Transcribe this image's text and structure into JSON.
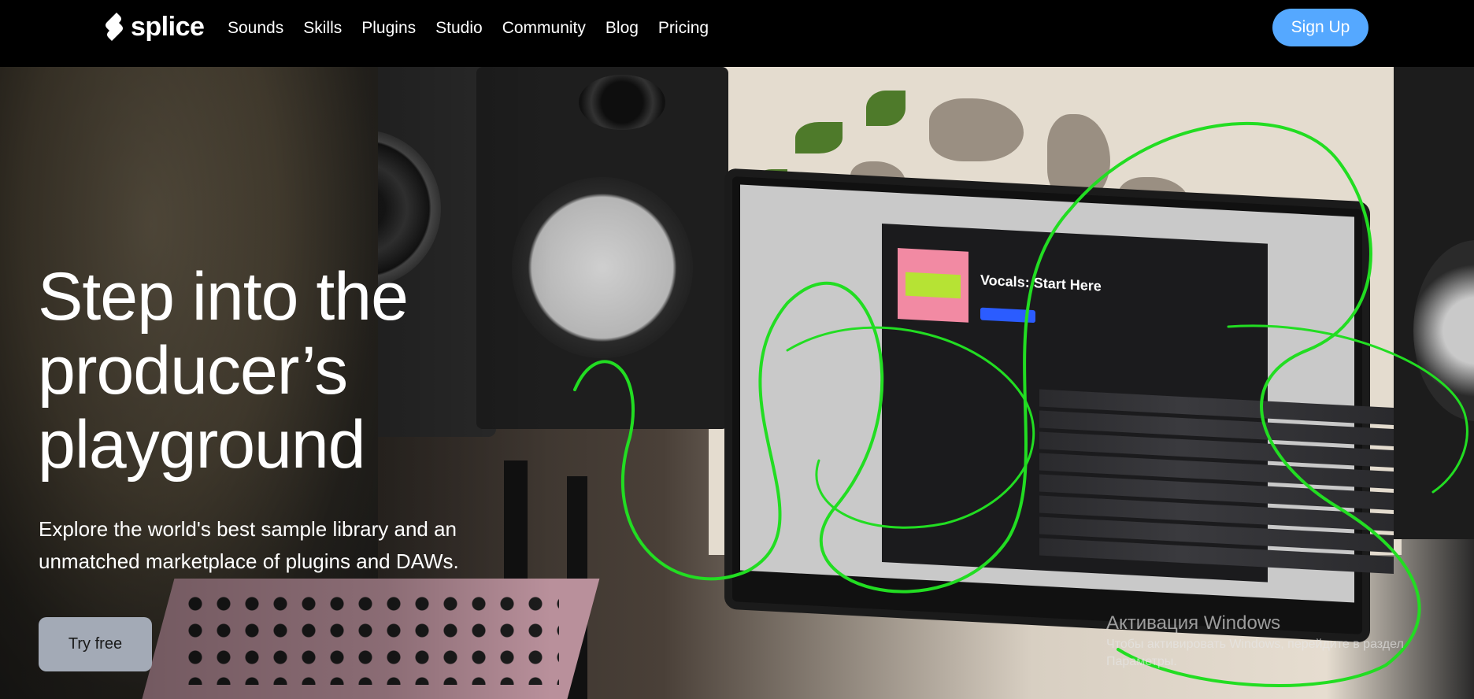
{
  "header": {
    "logo_text": "splice",
    "nav": [
      "Sounds",
      "Skills",
      "Plugins",
      "Studio",
      "Community",
      "Blog",
      "Pricing"
    ],
    "signup_label": "Sign Up"
  },
  "hero": {
    "title": "Step into the producer’s playground",
    "subtitle": "Explore the world's best sample library and an unmatched marketplace of plugins and DAWs.",
    "cta_label": "Try free",
    "screen_title": "Vocals: Start Here"
  },
  "windows_watermark": {
    "title": "Активация Windows",
    "subtitle": "Чтобы активировать Windows, перейдите в раздел Параметры."
  },
  "colors": {
    "accent": "#55a8ff",
    "cta_bg": "#a3aab6",
    "scribble": "#22dd22"
  },
  "icons": {
    "logo": "splice-logo-icon"
  }
}
